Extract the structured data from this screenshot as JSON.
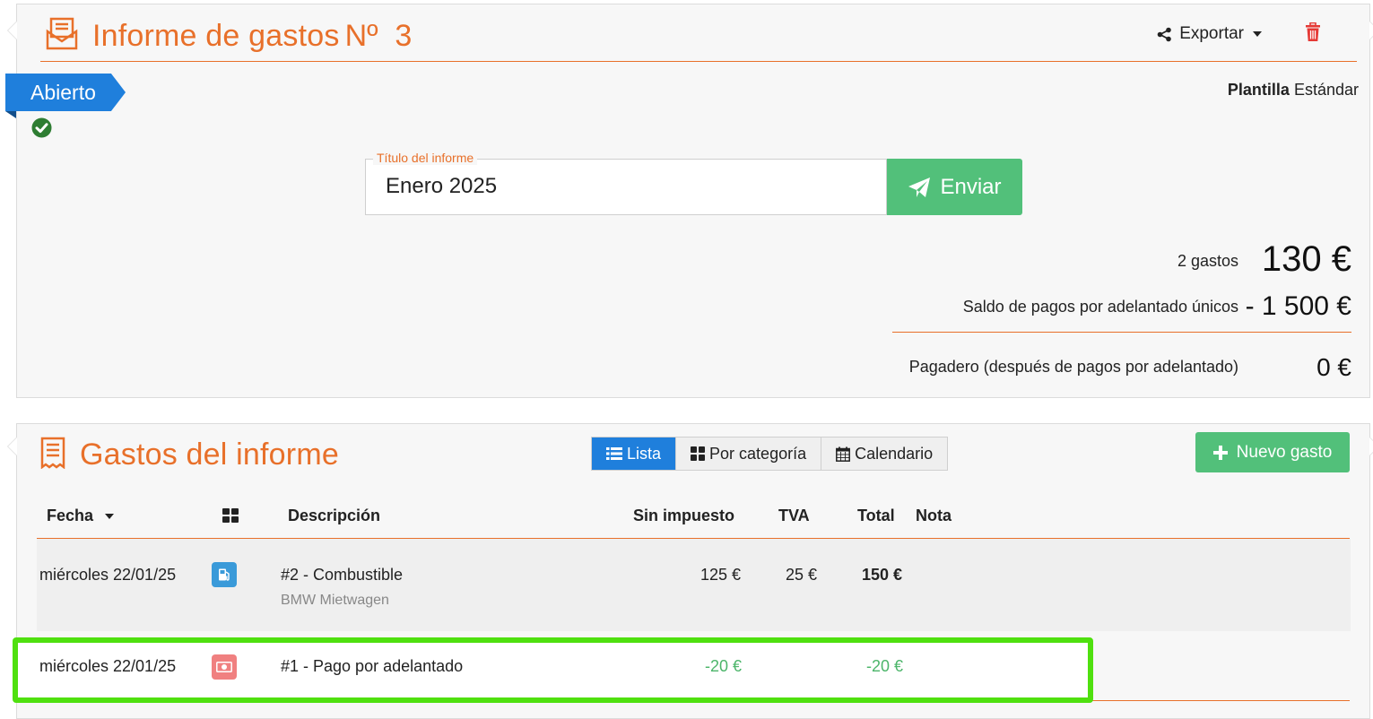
{
  "report": {
    "title": "Informe de gastos",
    "number": "Nº  3",
    "export_label": "Exportar",
    "status": "Abierto",
    "template_label": "Plantilla",
    "template_value": "Estándar",
    "field_legend": "Título del informe",
    "field_value": "Enero 2025",
    "send_label": "Enviar",
    "count_label": "2 gastos",
    "total_value": "130 €",
    "advance_label": "Saldo de pagos por adelantado únicos",
    "advance_value": "- 1 500 €",
    "payable_label": "Pagadero (después de pagos por adelantado)",
    "payable_value": "0 €"
  },
  "expenses": {
    "title": "Gastos del informe",
    "tabs": [
      {
        "label": "Lista",
        "icon": "list-icon",
        "active": true
      },
      {
        "label": "Por categoría",
        "icon": "grid-icon",
        "active": false
      },
      {
        "label": "Calendario",
        "icon": "calendar-icon",
        "active": false
      }
    ],
    "new_label": "Nuevo gasto",
    "columns": {
      "date": "Fecha",
      "description": "Descripción",
      "net": "Sin impuesto",
      "tax": "TVA",
      "total": "Total",
      "note": "Nota"
    },
    "rows": [
      {
        "date": "miércoles 22/01/25",
        "category_icon": "fuel-icon",
        "description": "#2 - Combustible",
        "sub": "BMW Mietwagen",
        "net": "125 €",
        "tax": "25 €",
        "total": "150 €"
      },
      {
        "date": "miércoles 22/01/25",
        "category_icon": "cash-icon",
        "description": "#1 - Pago por adelantado",
        "sub": "",
        "net": "-20 €",
        "tax": "",
        "total": "-20 €"
      }
    ]
  },
  "colors": {
    "accent": "#e8702a",
    "primary": "#1f7fdc",
    "success": "#52c07a",
    "highlight": "#4fe00f",
    "danger": "#e53935"
  }
}
